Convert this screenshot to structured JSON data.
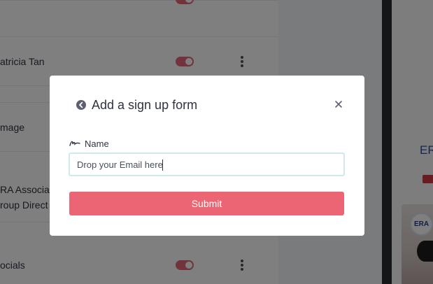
{
  "background": {
    "rows": [
      {
        "label": "atricia Tan"
      },
      {
        "label": "mage"
      },
      {
        "label_line1": "RA Associat",
        "label_line2": "roup Direct"
      },
      {
        "label": "ocials"
      }
    ],
    "preview": {
      "brand_text": "ER",
      "logo_text": "ERA"
    }
  },
  "modal": {
    "title": "Add a sign up form",
    "back_icon": "circle-chevron-left-icon",
    "close_icon": "close-icon",
    "close_glyph": "×",
    "field": {
      "icon": "signature-icon",
      "label": "Name",
      "placeholder": "Drop your Email here",
      "value": ""
    },
    "submit_label": "Submit"
  },
  "colors": {
    "accent": "#ec6574",
    "input_border": "#cfe9ea",
    "toggle_on": "#e6677a"
  }
}
